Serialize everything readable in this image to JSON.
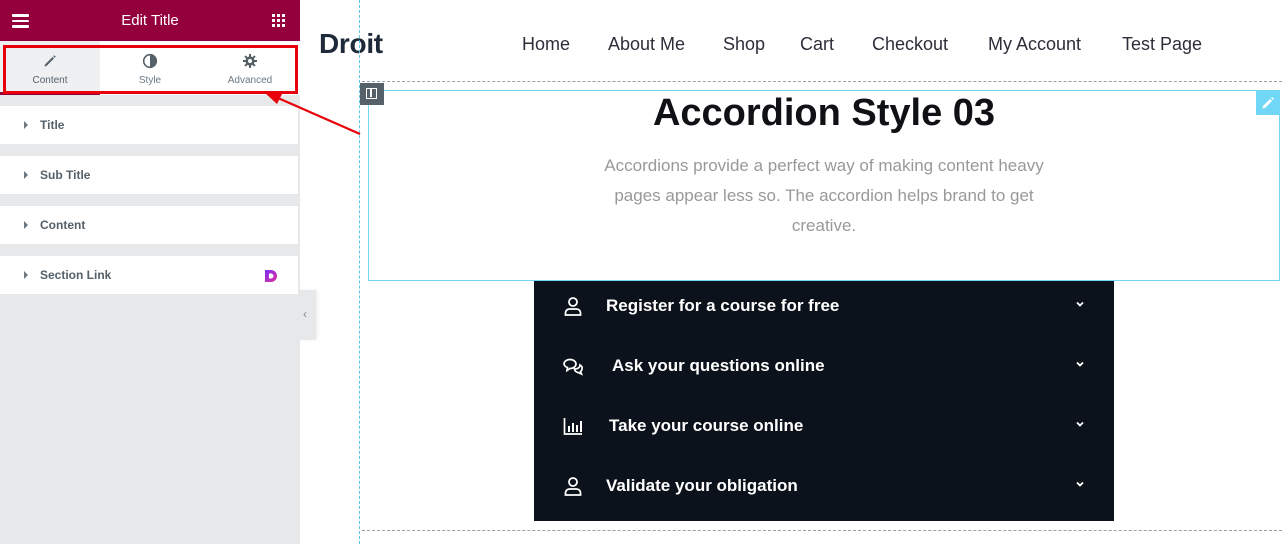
{
  "panel": {
    "title": "Edit Title",
    "tabs": [
      {
        "label": "Content",
        "icon": "pencil-icon"
      },
      {
        "label": "Style",
        "icon": "half-circle-icon"
      },
      {
        "label": "Advanced",
        "icon": "gear-icon"
      }
    ],
    "sections": [
      {
        "label": "Title"
      },
      {
        "label": "Sub Title"
      },
      {
        "label": "Content"
      },
      {
        "label": "Section Link"
      }
    ],
    "accent_color": "#93003c"
  },
  "site": {
    "logo": "Droit",
    "nav": [
      "Home",
      "About Me",
      "Shop",
      "Cart",
      "Checkout",
      "My Account",
      "Test Page"
    ],
    "heading": "Accordion Style 03",
    "subtitle": "Accordions provide a perfect way of making content heavy pages appear less so. The accordion helps brand to get creative.",
    "accordion": [
      {
        "label": "Register for a course for free",
        "icon": "user-icon"
      },
      {
        "label": "Ask your questions online",
        "icon": "chat-icon"
      },
      {
        "label": "Take your course online",
        "icon": "bar-chart-icon"
      },
      {
        "label": "Validate your obligation",
        "icon": "user-icon"
      }
    ],
    "accordion_bg": "#0c121b"
  }
}
